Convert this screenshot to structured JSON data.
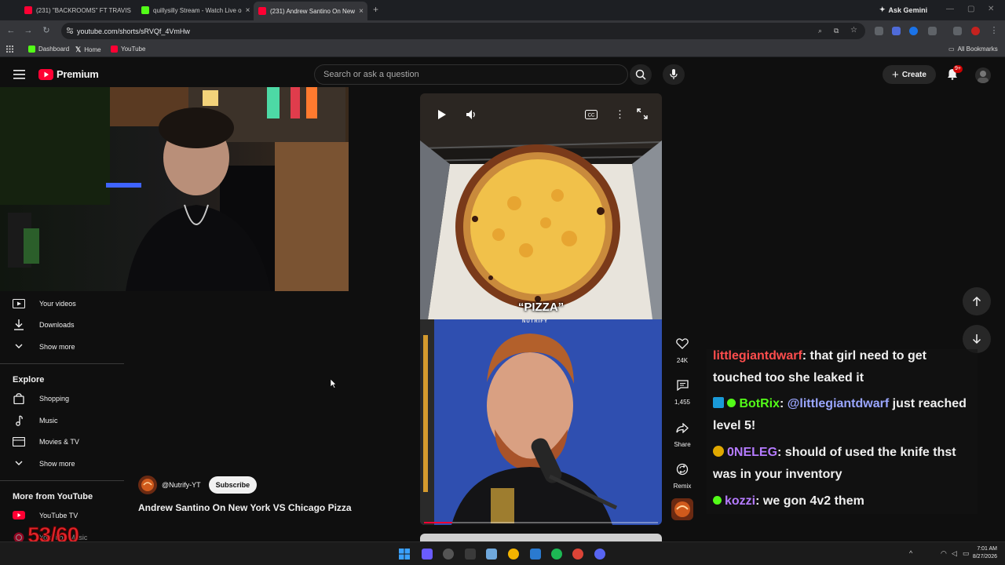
{
  "browser": {
    "tabs": [
      {
        "title": "(231) \"BACKROOMS\" FT TRAVIS",
        "active": false,
        "favicon_color": "#ff0033"
      },
      {
        "title": "quillysilly Stream - Watch Live o",
        "active": false,
        "favicon_color": "#53fc18"
      },
      {
        "title": "(231) Andrew Santino On New",
        "active": true,
        "favicon_color": "#ff0033"
      }
    ],
    "ask_gemini": "Ask Gemini",
    "url": "youtube.com/shorts/sRVQf_4VmHw",
    "bookmarks": [
      {
        "label": "Dashboard",
        "icon": "kick-icon",
        "color": "#53fc18"
      },
      {
        "label": "Home",
        "icon": "x-icon",
        "color": "#ffffff"
      },
      {
        "label": "YouTube",
        "icon": "youtube-icon",
        "color": "#ff0033"
      }
    ],
    "all_bookmarks": "All Bookmarks"
  },
  "youtube": {
    "logo_text": "Premium",
    "search_placeholder": "Search or ask a question",
    "create_label": "Create",
    "notification_badge": "9+",
    "accent_color": "#ff0033"
  },
  "sidebar": {
    "items": [
      {
        "label": "Your videos",
        "icon": "your-videos-icon"
      },
      {
        "label": "Downloads",
        "icon": "download-icon"
      },
      {
        "label": "Show more",
        "icon": "chevron-down-icon"
      }
    ],
    "explore_heading": "Explore",
    "explore_items": [
      {
        "label": "Shopping",
        "icon": "shopping-bag-icon"
      },
      {
        "label": "Music",
        "icon": "music-note-icon"
      },
      {
        "label": "Movies & TV",
        "icon": "film-icon"
      },
      {
        "label": "Show more",
        "icon": "chevron-down-icon"
      }
    ],
    "more_heading": "More from YouTube",
    "more_items": [
      {
        "label": "YouTube TV",
        "icon": "youtube-tv-icon"
      },
      {
        "label": "YouTube Music",
        "icon": "youtube-music-icon"
      }
    ]
  },
  "overlay": {
    "counter": "53/60"
  },
  "short": {
    "channel": "@Nutrify-YT",
    "subscribe_label": "Subscribe",
    "title": "Andrew Santino On New York VS Chicago Pizza",
    "caption": "“PIZZA”",
    "brand_watermark": "NUTRIFY",
    "likes": "24K",
    "comments": "1,455",
    "share_label": "Share",
    "remix_label": "Remix",
    "progress": 0.12
  },
  "chat": [
    {
      "user": "littlegiantdwarf",
      "user_color": "#ff4d4d",
      "text": ": that girl need to get touched too she leaked it",
      "badges": []
    },
    {
      "user": "BotRix",
      "user_color": "#53fc18",
      "text_prefix": ": ",
      "mention": "@littlegiantdwarf",
      "mention_color": "#9aa6ff",
      "text": " just reached level 5!",
      "badges": [
        "bot-badge-icon",
        "verified-badge-icon"
      ]
    },
    {
      "user": "0NELEG",
      "user_color": "#b57bff",
      "text": ": should of used the knife thst was in your inventory",
      "badges": [
        "sub-badge-icon"
      ]
    },
    {
      "user": "kozzi",
      "user_color": "#b57bff",
      "text": ": we gon 4v2 them",
      "badges": [
        "verified-badge-icon"
      ]
    }
  ],
  "taskbar": {
    "time": "7:01 AM",
    "date": "8/27/2026"
  }
}
